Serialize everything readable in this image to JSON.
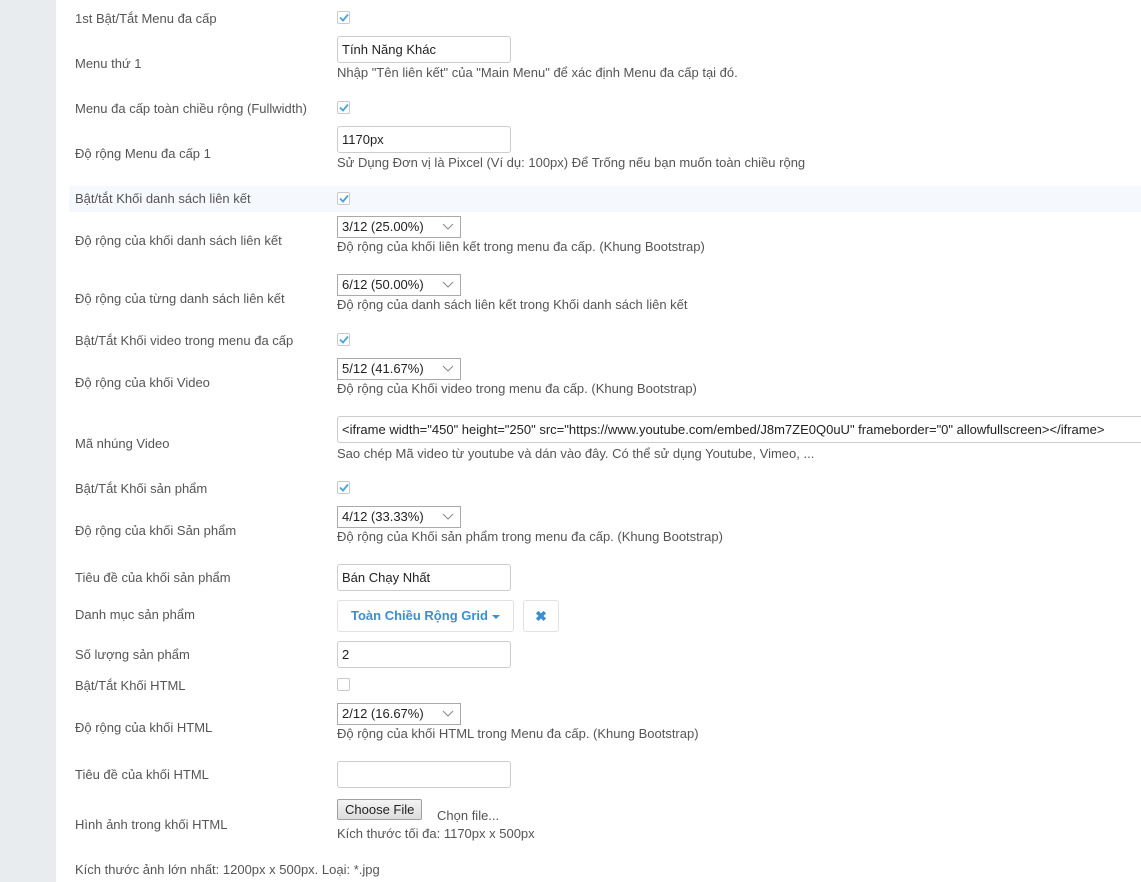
{
  "colors": {
    "accent": "#3a8fd0",
    "check": "#4aa3df",
    "sidebar": "#e9ecef",
    "highlight_row": "#f5f9fd"
  },
  "fields": {
    "menu_toggle": {
      "label": "1st Bật/Tắt Menu đa cấp",
      "checked": true
    },
    "menu_1": {
      "label": "Menu thứ 1",
      "value": "Tính Năng Khác",
      "help": "Nhập \"Tên liên kết\" của \"Main Menu\" để xác định Menu đa cấp tại đó."
    },
    "fullwidth": {
      "label": "Menu đa cấp toàn chiều rộng (Fullwidth)",
      "checked": true
    },
    "menu_width": {
      "label": "Độ rộng Menu đa cấp 1",
      "value": "1170px",
      "help": "Sử Dụng Đơn vị là Pixcel (Ví dụ: 100px) Để Trống nếu bạn muốn toàn chiều rộng"
    },
    "links_toggle": {
      "label": "Bật/tắt Khối danh sách liên kết",
      "checked": true
    },
    "links_block_width": {
      "label": "Độ rộng của khối danh sách liên kết",
      "value": "3/12 (25.00%)",
      "help": "Độ rộng của khối liên kết trong menu đa cấp. (Khung Bootstrap)"
    },
    "links_list_width": {
      "label": "Độ rộng của từng danh sách liên kết",
      "value": "6/12 (50.00%)",
      "help": "Độ rộng của danh sách liên kết trong Khối danh sách liên kết"
    },
    "video_toggle": {
      "label": "Bật/Tắt Khối video trong menu đa cấp",
      "checked": true
    },
    "video_width": {
      "label": "Độ rộng của khối Video",
      "value": "5/12 (41.67%)",
      "help": "Độ rộng của Khối video trong menu đa cấp. (Khung Bootstrap)"
    },
    "video_embed": {
      "label": "Mã nhúng Video",
      "value": "<iframe width=\"450\" height=\"250\" src=\"https://www.youtube.com/embed/J8m7ZE0Q0uU\" frameborder=\"0\" allowfullscreen></iframe>",
      "help": "Sao chép Mã video từ youtube và dán vào đây. Có thể sử dụng Youtube, Vimeo, ..."
    },
    "product_toggle": {
      "label": "Bật/Tắt Khối sản phẩm",
      "checked": true
    },
    "product_width": {
      "label": "Độ rộng của khối Sản phẩm",
      "value": "4/12 (33.33%)",
      "help": "Độ rộng của Khối sản phẩm trong menu đa cấp. (Khung Bootstrap)"
    },
    "product_title": {
      "label": "Tiêu đề của khối sản phẩm",
      "value": "Bán Chạy Nhất"
    },
    "product_category": {
      "label": "Danh mục sản phẩm",
      "value": "Toàn Chiều Rộng Grid",
      "clear_icon": "✖"
    },
    "product_count": {
      "label": "Số lượng sản phẩm",
      "value": "2"
    },
    "html_toggle": {
      "label": "Bật/Tắt Khối HTML",
      "checked": false
    },
    "html_width": {
      "label": "Độ rộng của khối HTML",
      "value": "2/12 (16.67%)",
      "help": "Độ rộng của khối HTML trong Menu đa cấp. (Khung Bootstrap)"
    },
    "html_title": {
      "label": "Tiêu đề của khối HTML",
      "value": ""
    },
    "html_image": {
      "label": "Hình ảnh trong khối HTML",
      "button": "Choose File",
      "file_name": "Chọn file...",
      "help": "Kích thước tối đa: 1170px x 500px"
    }
  },
  "footer_note": "Kích thước ảnh lớn nhất: 1200px x 500px. Loại: *.jpg"
}
